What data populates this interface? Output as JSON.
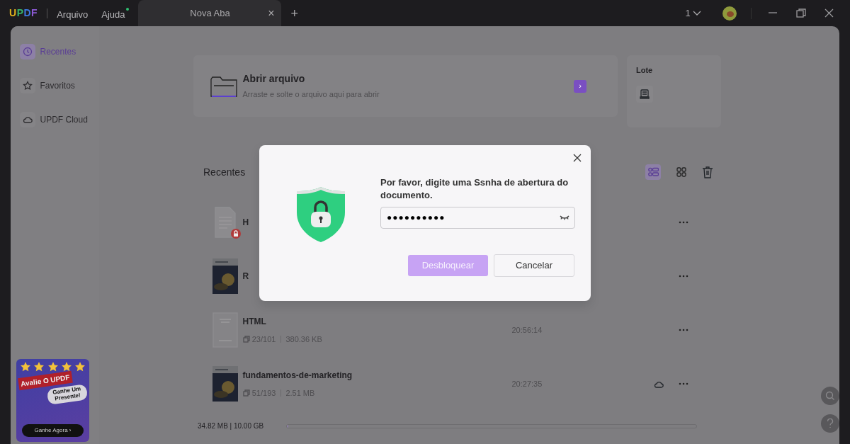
{
  "app": {
    "logo": "UPDF",
    "menu": [
      {
        "label": "Arquivo",
        "notice": false
      },
      {
        "label": "Ajuda",
        "notice": true
      }
    ],
    "tabs": [
      {
        "label": "Nova Aba",
        "selected": true,
        "close": "×"
      }
    ],
    "new_tab": "+",
    "page_count": "1"
  },
  "sidebar": {
    "items": [
      {
        "label": "Recentes",
        "selected": true
      },
      {
        "label": "Favoritos",
        "selected": false
      },
      {
        "label": "UPDF Cloud",
        "selected": false
      }
    ],
    "promo": {
      "title": "Avalie O UPDF",
      "bubble": "Ganhe Um Presente!",
      "button": "Ganhe Agora ›",
      "stars": 5
    }
  },
  "open_card": {
    "title": "Abrir arquivo",
    "subtitle": "Arraste e solte o arquivo aqui para abrir",
    "arrow": "›"
  },
  "batch_card": {
    "title": "Lote"
  },
  "recent": {
    "heading": "Recentes",
    "views": [
      {
        "kind": "list",
        "selected": true
      },
      {
        "kind": "grid",
        "selected": false
      }
    ],
    "files": [
      {
        "name": "H",
        "kind": "document",
        "locked": true,
        "cloud": false
      },
      {
        "name": "R",
        "kind": "picture",
        "locked": false,
        "cloud": false
      },
      {
        "name": "HTML",
        "kind": "page",
        "locked": false,
        "pages": "23/101",
        "size": "380.36 KB",
        "time": "20:56:14",
        "cloud": false
      },
      {
        "name": "fundamentos-de-marketing",
        "kind": "picture",
        "locked": false,
        "pages": "51/193",
        "size": "2.51 MB",
        "time": "20:27:35",
        "cloud": true
      }
    ]
  },
  "storage": {
    "text": "34.82 MB | 10.00 GB",
    "level": 0.004
  },
  "dialog": {
    "message": "Por favor, digite uma Ssnha de abertura do documento.",
    "password": "●●●●●●●●●●",
    "buttons": [
      {
        "label": "Desbloquear",
        "kind": "primary"
      },
      {
        "label": "Cancelar",
        "kind": "secondary"
      }
    ]
  }
}
